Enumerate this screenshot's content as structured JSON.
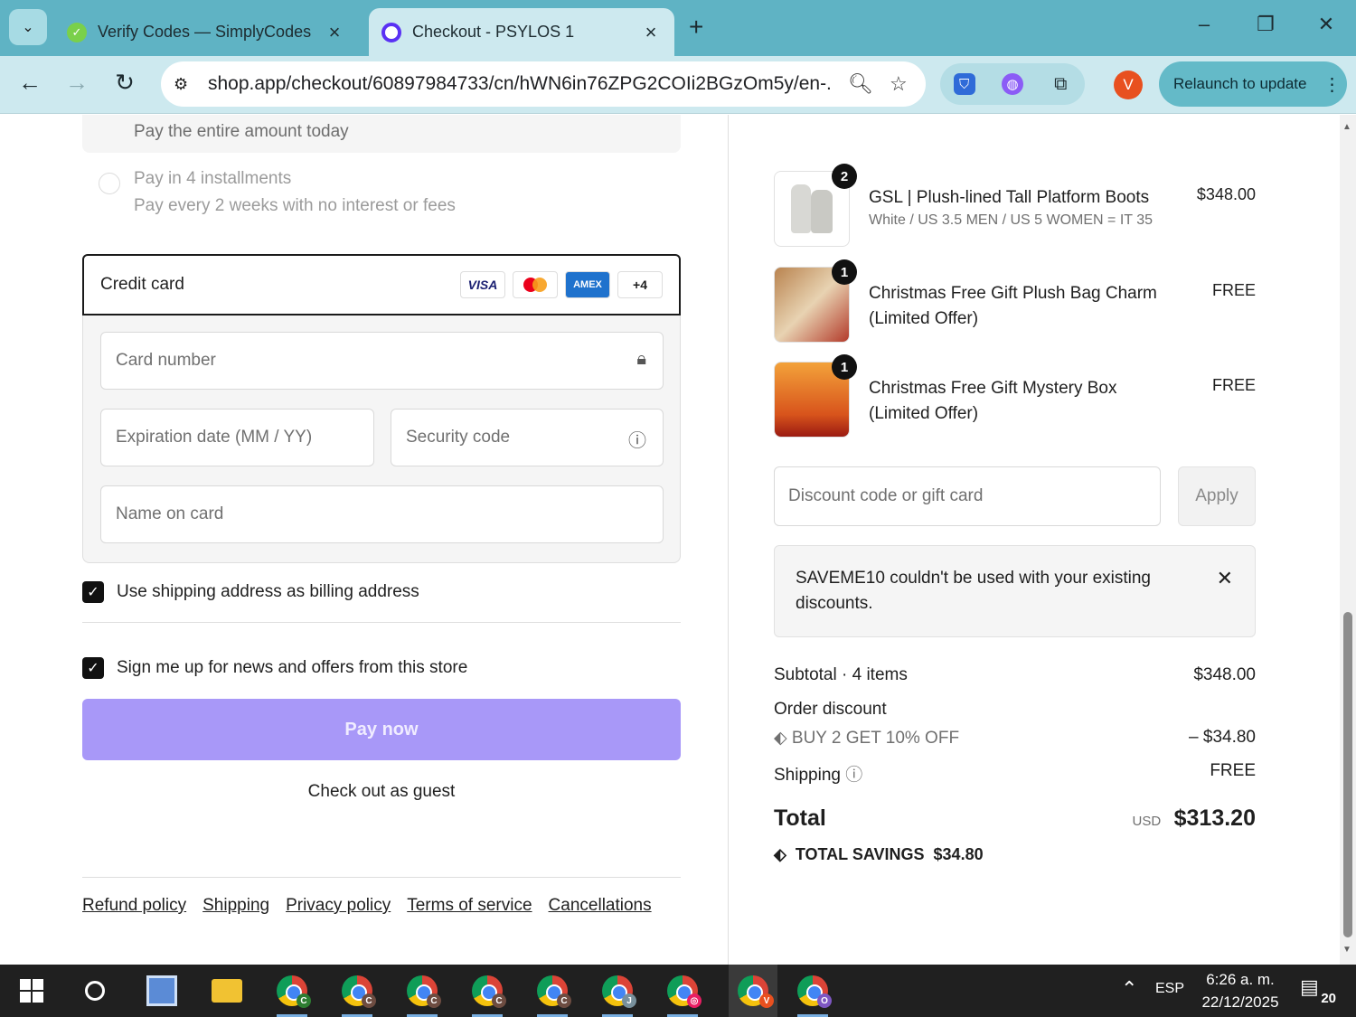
{
  "browser": {
    "tabs": [
      {
        "title": "Verify Codes — SimplyCodes",
        "active": false
      },
      {
        "title": "Checkout - PSYLOS 1",
        "active": true
      }
    ],
    "url": "shop.app/checkout/60897984733/cn/hWN6in76ZPG2COIi2BGzOm5y/en-...",
    "profile_initial": "V",
    "relaunch_label": "Relaunch to update"
  },
  "payment": {
    "pay_today": "Pay the entire amount today",
    "installments_title": "Pay in 4 installments",
    "installments_sub": "Pay every 2 weeks with no interest or fees",
    "credit_card_label": "Credit card",
    "brands": [
      "VISA",
      "Mastercard",
      "AMEX",
      "+4"
    ],
    "card_number_placeholder": "Card number",
    "expiration_placeholder": "Expiration date (MM / YY)",
    "security_placeholder": "Security code",
    "name_placeholder": "Name on card",
    "billing_checkbox": "Use shipping address as billing address",
    "news_checkbox": "Sign me up for news and offers from this store",
    "pay_now": "Pay now",
    "guest": "Check out as guest"
  },
  "footer_links": [
    "Refund policy",
    "Shipping",
    "Privacy policy",
    "Terms of service",
    "Cancellations"
  ],
  "order": {
    "items": [
      {
        "name": "GSL | Plush-lined Tall Platform Boots",
        "variant": "White / US 3.5 MEN / US 5 WOMEN = IT 35",
        "price": "$348.00",
        "qty": "2"
      },
      {
        "name": "Christmas Free Gift Plush Bag Charm   (Limited Offer)",
        "variant": "",
        "price": "FREE",
        "qty": "1"
      },
      {
        "name": "Christmas Free Gift Mystery Box  (Limited Offer)",
        "variant": "",
        "price": "FREE",
        "qty": "1"
      }
    ],
    "discount_placeholder": "Discount code or gift card",
    "apply": "Apply",
    "error": "SAVEME10 couldn't be used with your existing discounts.",
    "subtotal_label": "Subtotal · 4 items",
    "subtotal": "$348.00",
    "order_discount_label": "Order discount",
    "discount_code": "BUY 2 GET 10% OFF",
    "discount_amount": "– $34.80",
    "shipping_label": "Shipping",
    "shipping": "FREE",
    "total_label": "Total",
    "currency": "USD",
    "total": "$313.20",
    "savings_label": "TOTAL SAVINGS",
    "savings": "$34.80"
  },
  "taskbar": {
    "lang": "ESP",
    "time": "6:26 a. m.",
    "date": "22/12/2025",
    "notifications": "20",
    "chrome_badges": [
      "C",
      "C",
      "C",
      "C",
      "C",
      "J",
      "",
      "V",
      "O"
    ]
  },
  "colors": {
    "accent": "#a898f8",
    "tabstrip": "#5fb3c4",
    "toolbar": "#cde9ef"
  }
}
